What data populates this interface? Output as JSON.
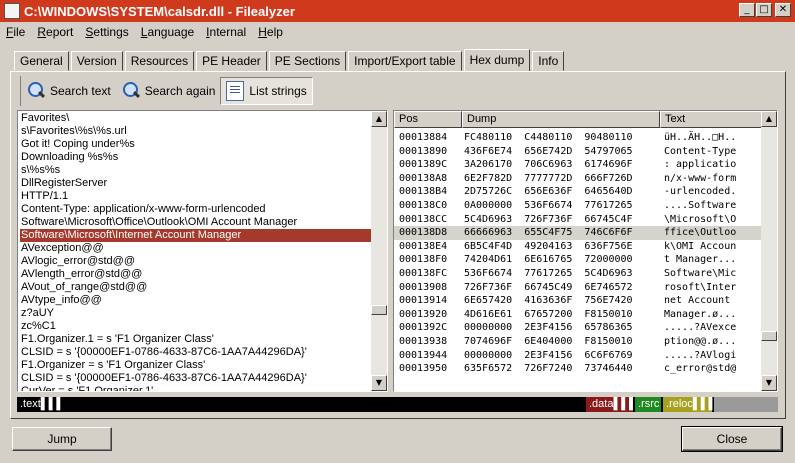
{
  "window": {
    "title": "C:\\WINDOWS\\SYSTEM\\calsdr.dll - Filealyzer",
    "minimize_glyph": "_",
    "maximize_glyph": "□",
    "close_glyph": "✕"
  },
  "menu": [
    "File",
    "Report",
    "Settings",
    "Language",
    "Internal",
    "Help"
  ],
  "tabs": [
    "General",
    "Version",
    "Resources",
    "PE Header",
    "PE Sections",
    "Import/Export table",
    "Hex dump",
    "Info"
  ],
  "active_tab": "Hex dump",
  "toolbar": {
    "search_text": "Search text",
    "search_again": "Search again",
    "list_strings": "List strings"
  },
  "strings": [
    "Favorites\\",
    "s\\Favorites\\%s\\%s.url",
    "Got it! Coping under%s",
    "Downloading %s%s",
    "s\\%s%s",
    "DllRegisterServer",
    "HTTP/1.1",
    "Content-Type: application/x-www-form-urlencoded",
    "Software\\Microsoft\\Office\\Outlook\\OMI Account Manager",
    "Software\\Microsoft\\Internet Account Manager",
    "AVexception@@",
    "AVlogic_error@std@@",
    "AVlength_error@std@@",
    "AVout_of_range@std@@",
    "AVtype_info@@",
    "z?aUY",
    "zc%C1",
    "F1.Organizer.1 = s 'F1 Organizer Class'",
    "CLSID = s '{00000EF1-0786-4633-87C6-1AA7A44296DA}'",
    "F1.Organizer = s 'F1 Organizer Class'",
    "CLSID = s '{00000EF1-0786-4633-87C6-1AA7A44296DA}'",
    "CurVer = s 'F1.Organizer.1'"
  ],
  "selected_string_index": 9,
  "hex": {
    "headers": {
      "pos": "Pos",
      "dump": "Dump",
      "text": "Text"
    },
    "rows": [
      {
        "pos": "00013884",
        "dump": "FC480110  C4480110  90480110",
        "text": "üH..ÄH..□H.."
      },
      {
        "pos": "00013890",
        "dump": "436F6E74  656E742D  54797065",
        "text": "Content-Type"
      },
      {
        "pos": "0001389C",
        "dump": "3A206170  706C6963  6174696F",
        "text": ": applicatio"
      },
      {
        "pos": "000138A8",
        "dump": "6E2F782D  7777772D  666F726D",
        "text": "n/x-www-form"
      },
      {
        "pos": "000138B4",
        "dump": "2D75726C  656E636F  6465640D",
        "text": "-urlencoded."
      },
      {
        "pos": "000138C0",
        "dump": "0A000000  536F6674  77617265",
        "text": "....Software"
      },
      {
        "pos": "000138CC",
        "dump": "5C4D6963  726F736F  66745C4F",
        "text": "\\Microsoft\\O"
      },
      {
        "pos": "000138D8",
        "dump": "66666963  655C4F75  746C6F6F",
        "text": "ffice\\Outloo"
      },
      {
        "pos": "000138E4",
        "dump": "6B5C4F4D  49204163  636F756E",
        "text": "k\\OMI Accoun"
      },
      {
        "pos": "000138F0",
        "dump": "74204D61  6E616765  72000000",
        "text": "t Manager..."
      },
      {
        "pos": "000138FC",
        "dump": "536F6674  77617265  5C4D6963",
        "text": "Software\\Mic"
      },
      {
        "pos": "00013908",
        "dump": "726F736F  66745C49  6E746572",
        "text": "rosoft\\Inter"
      },
      {
        "pos": "00013914",
        "dump": "6E657420  4163636F  756E7420",
        "text": "net Account "
      },
      {
        "pos": "00013920",
        "dump": "4D616E61  67657200  F8150010",
        "text": "Manager.ø..."
      },
      {
        "pos": "0001392C",
        "dump": "00000000  2E3F4156  65786365",
        "text": ".....?AVexce"
      },
      {
        "pos": "00013938",
        "dump": "7074696F  6E404000  F8150010",
        "text": "ption@@.ø..."
      },
      {
        "pos": "00013944",
        "dump": "00000000  2E3F4156  6C6F6769",
        "text": ".....?AVlogi"
      },
      {
        "pos": "00013950",
        "dump": "635F6572  726F7240  73746440",
        "text": "c_error@std@"
      }
    ],
    "selected_row_index": 7
  },
  "sections": [
    {
      "label": ".text",
      "color": "#000000",
      "text_color": "#ffffff"
    },
    {
      "label": ".data",
      "color": "#8b1a1a",
      "text_color": "#ffffff"
    },
    {
      "label": ".rsrc",
      "color": "#1f8a1f",
      "text_color": "#ffffff"
    },
    {
      "label": ".reloc",
      "color": "#a8a020",
      "text_color": "#ffffff"
    }
  ],
  "buttons": {
    "jump": "Jump",
    "close": "Close"
  }
}
